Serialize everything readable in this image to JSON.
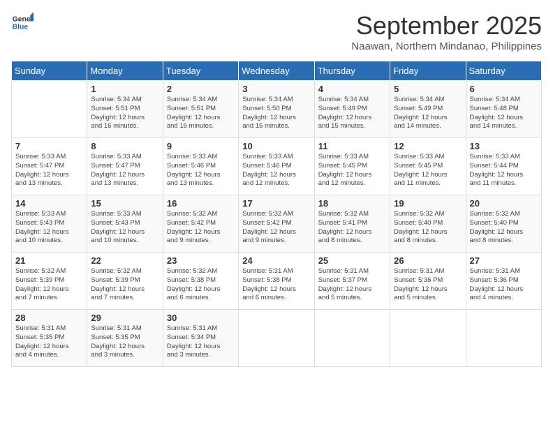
{
  "header": {
    "logo_line1": "General",
    "logo_line2": "Blue",
    "month": "September 2025",
    "location": "Naawan, Northern Mindanao, Philippines"
  },
  "days_of_week": [
    "Sunday",
    "Monday",
    "Tuesday",
    "Wednesday",
    "Thursday",
    "Friday",
    "Saturday"
  ],
  "weeks": [
    [
      {
        "day": "",
        "info": ""
      },
      {
        "day": "1",
        "info": "Sunrise: 5:34 AM\nSunset: 5:51 PM\nDaylight: 12 hours\nand 16 minutes."
      },
      {
        "day": "2",
        "info": "Sunrise: 5:34 AM\nSunset: 5:51 PM\nDaylight: 12 hours\nand 16 minutes."
      },
      {
        "day": "3",
        "info": "Sunrise: 5:34 AM\nSunset: 5:50 PM\nDaylight: 12 hours\nand 15 minutes."
      },
      {
        "day": "4",
        "info": "Sunrise: 5:34 AM\nSunset: 5:49 PM\nDaylight: 12 hours\nand 15 minutes."
      },
      {
        "day": "5",
        "info": "Sunrise: 5:34 AM\nSunset: 5:49 PM\nDaylight: 12 hours\nand 14 minutes."
      },
      {
        "day": "6",
        "info": "Sunrise: 5:34 AM\nSunset: 5:48 PM\nDaylight: 12 hours\nand 14 minutes."
      }
    ],
    [
      {
        "day": "7",
        "info": "Sunrise: 5:33 AM\nSunset: 5:47 PM\nDaylight: 12 hours\nand 13 minutes."
      },
      {
        "day": "8",
        "info": "Sunrise: 5:33 AM\nSunset: 5:47 PM\nDaylight: 12 hours\nand 13 minutes."
      },
      {
        "day": "9",
        "info": "Sunrise: 5:33 AM\nSunset: 5:46 PM\nDaylight: 12 hours\nand 13 minutes."
      },
      {
        "day": "10",
        "info": "Sunrise: 5:33 AM\nSunset: 5:46 PM\nDaylight: 12 hours\nand 12 minutes."
      },
      {
        "day": "11",
        "info": "Sunrise: 5:33 AM\nSunset: 5:45 PM\nDaylight: 12 hours\nand 12 minutes."
      },
      {
        "day": "12",
        "info": "Sunrise: 5:33 AM\nSunset: 5:45 PM\nDaylight: 12 hours\nand 11 minutes."
      },
      {
        "day": "13",
        "info": "Sunrise: 5:33 AM\nSunset: 5:44 PM\nDaylight: 12 hours\nand 11 minutes."
      }
    ],
    [
      {
        "day": "14",
        "info": "Sunrise: 5:33 AM\nSunset: 5:43 PM\nDaylight: 12 hours\nand 10 minutes."
      },
      {
        "day": "15",
        "info": "Sunrise: 5:33 AM\nSunset: 5:43 PM\nDaylight: 12 hours\nand 10 minutes."
      },
      {
        "day": "16",
        "info": "Sunrise: 5:32 AM\nSunset: 5:42 PM\nDaylight: 12 hours\nand 9 minutes."
      },
      {
        "day": "17",
        "info": "Sunrise: 5:32 AM\nSunset: 5:42 PM\nDaylight: 12 hours\nand 9 minutes."
      },
      {
        "day": "18",
        "info": "Sunrise: 5:32 AM\nSunset: 5:41 PM\nDaylight: 12 hours\nand 8 minutes."
      },
      {
        "day": "19",
        "info": "Sunrise: 5:32 AM\nSunset: 5:40 PM\nDaylight: 12 hours\nand 8 minutes."
      },
      {
        "day": "20",
        "info": "Sunrise: 5:32 AM\nSunset: 5:40 PM\nDaylight: 12 hours\nand 8 minutes."
      }
    ],
    [
      {
        "day": "21",
        "info": "Sunrise: 5:32 AM\nSunset: 5:39 PM\nDaylight: 12 hours\nand 7 minutes."
      },
      {
        "day": "22",
        "info": "Sunrise: 5:32 AM\nSunset: 5:39 PM\nDaylight: 12 hours\nand 7 minutes."
      },
      {
        "day": "23",
        "info": "Sunrise: 5:32 AM\nSunset: 5:38 PM\nDaylight: 12 hours\nand 6 minutes."
      },
      {
        "day": "24",
        "info": "Sunrise: 5:31 AM\nSunset: 5:38 PM\nDaylight: 12 hours\nand 6 minutes."
      },
      {
        "day": "25",
        "info": "Sunrise: 5:31 AM\nSunset: 5:37 PM\nDaylight: 12 hours\nand 5 minutes."
      },
      {
        "day": "26",
        "info": "Sunrise: 5:31 AM\nSunset: 5:36 PM\nDaylight: 12 hours\nand 5 minutes."
      },
      {
        "day": "27",
        "info": "Sunrise: 5:31 AM\nSunset: 5:36 PM\nDaylight: 12 hours\nand 4 minutes."
      }
    ],
    [
      {
        "day": "28",
        "info": "Sunrise: 5:31 AM\nSunset: 5:35 PM\nDaylight: 12 hours\nand 4 minutes."
      },
      {
        "day": "29",
        "info": "Sunrise: 5:31 AM\nSunset: 5:35 PM\nDaylight: 12 hours\nand 3 minutes."
      },
      {
        "day": "30",
        "info": "Sunrise: 5:31 AM\nSunset: 5:34 PM\nDaylight: 12 hours\nand 3 minutes."
      },
      {
        "day": "",
        "info": ""
      },
      {
        "day": "",
        "info": ""
      },
      {
        "day": "",
        "info": ""
      },
      {
        "day": "",
        "info": ""
      }
    ]
  ]
}
